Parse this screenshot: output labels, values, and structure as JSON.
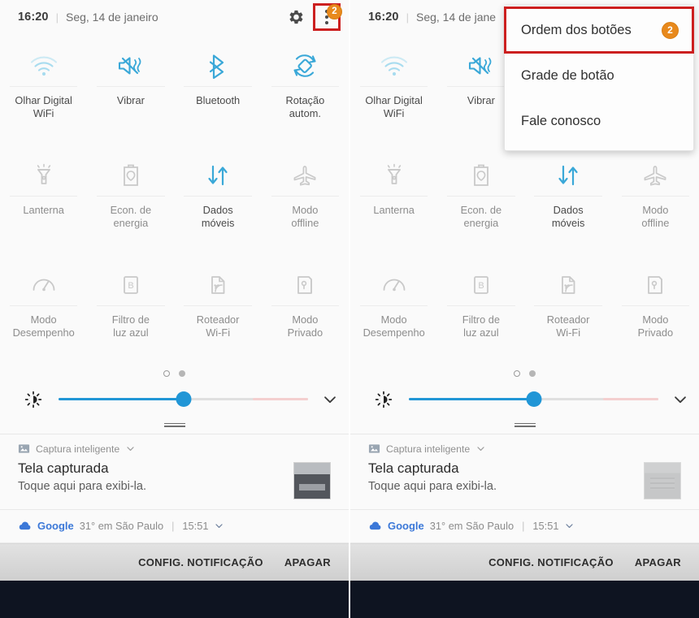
{
  "accent": {
    "active_icon": "#3aa8d8",
    "faded_icon": "#a8dcef",
    "inactive_icon": "#c9c9c9",
    "badge_orange": "#e8891c",
    "highlight_red": "#cc1f1f",
    "slider_blue": "#2196d6",
    "google_blue": "#3b78d8"
  },
  "header": {
    "time": "16:20",
    "separator": "|",
    "date_full": "Seg, 14 de janeiro",
    "date_clipped": "Seg, 14 de jane",
    "gear_icon": "gear-icon",
    "kebab_icon": "overflow-menu-icon",
    "badge_count": "2"
  },
  "toggles": {
    "rows": [
      [
        {
          "label": "Olhar Digital\nWiFi",
          "label_lines": [
            "Olhar Digital",
            "WiFi"
          ],
          "icon": "wifi-icon",
          "state": "connecting"
        },
        {
          "label": "Vibrar",
          "label_lines": [
            "Vibrar"
          ],
          "icon": "vibrate-icon",
          "state": "on"
        },
        {
          "label": "Bluetooth",
          "label_lines": [
            "Bluetooth"
          ],
          "icon": "bluetooth-icon",
          "state": "on"
        },
        {
          "label": "Rotação autom.",
          "label_lines": [
            "Rotação",
            "autom."
          ],
          "icon": "auto-rotate-icon",
          "state": "on"
        }
      ],
      [
        {
          "label": "Lanterna",
          "label_lines": [
            "Lanterna"
          ],
          "icon": "flashlight-icon",
          "state": "off"
        },
        {
          "label": "Econ. de energia",
          "label_lines": [
            "Econ. de",
            "energia"
          ],
          "icon": "battery-saver-icon",
          "state": "off"
        },
        {
          "label": "Dados móveis",
          "label_lines": [
            "Dados",
            "móveis"
          ],
          "icon": "mobile-data-icon",
          "state": "on"
        },
        {
          "label": "Modo offline",
          "label_lines": [
            "Modo",
            "offline"
          ],
          "icon": "airplane-icon",
          "state": "off"
        }
      ],
      [
        {
          "label": "Modo Desempenho",
          "label_lines": [
            "Modo",
            "Desempenho"
          ],
          "icon": "performance-mode-icon",
          "state": "off"
        },
        {
          "label": "Filtro de luz azul",
          "label_lines": [
            "Filtro de",
            "luz azul"
          ],
          "icon": "blue-light-filter-icon",
          "state": "off"
        },
        {
          "label": "Roteador Wi-Fi",
          "label_lines": [
            "Roteador",
            "Wi-Fi"
          ],
          "icon": "wifi-hotspot-icon",
          "state": "off"
        },
        {
          "label": "Modo Privado",
          "label_lines": [
            "Modo",
            "Privado"
          ],
          "icon": "private-mode-icon",
          "state": "off"
        }
      ]
    ]
  },
  "pager": {
    "pages": 2,
    "current": 1
  },
  "brightness": {
    "value_percent": 50,
    "icon": "brightness-icon",
    "expand_icon": "chevron-down-icon"
  },
  "notification": {
    "app_name": "Captura inteligente",
    "app_icon": "image-icon",
    "expand_icon": "chevron-down-icon",
    "title": "Tela capturada",
    "body": "Toque aqui para exibi-la.",
    "thumbnail": "screenshot-thumbnail"
  },
  "weather": {
    "icon": "cloud-icon",
    "source": "Google",
    "text": "31° em São Paulo",
    "pipe": "|",
    "time": "15:51",
    "expand_icon": "chevron-down-icon"
  },
  "action_bar": {
    "settings_label": "CONFIG. NOTIFICAÇÃO",
    "clear_label": "APAGAR"
  },
  "popup_menu": {
    "items": [
      {
        "label": "Ordem dos botões",
        "badge": "2",
        "highlighted": true
      },
      {
        "label": "Grade de botão",
        "badge": "",
        "highlighted": false
      },
      {
        "label": "Fale conosco",
        "badge": "",
        "highlighted": false
      }
    ]
  }
}
